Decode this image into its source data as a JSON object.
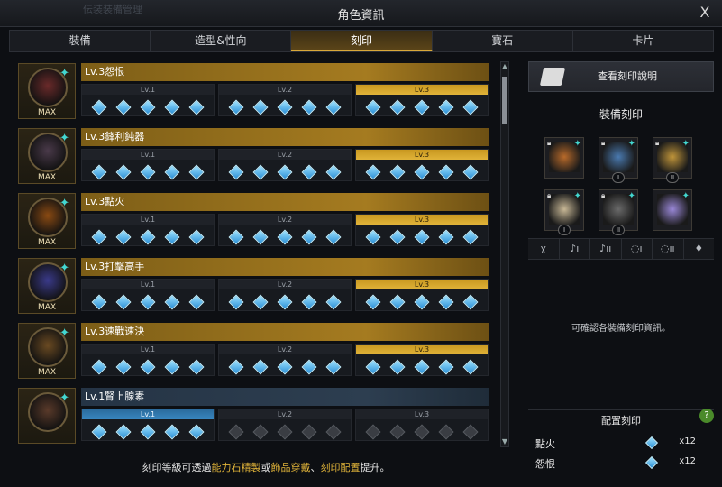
{
  "window": {
    "title": "角色資訊",
    "ghost_title": "伝装装備管理",
    "close_label": "X"
  },
  "tabs": [
    {
      "label": "裝備",
      "active": false
    },
    {
      "label": "造型&性向",
      "active": false
    },
    {
      "label": "刻印",
      "active": true
    },
    {
      "label": "寶石",
      "active": false
    },
    {
      "label": "卡片",
      "active": false
    }
  ],
  "level_labels": [
    "Lv.1",
    "Lv.2",
    "Lv.3"
  ],
  "engravings": [
    {
      "title": "Lv.3怨恨",
      "badge": "MAX",
      "level": 3,
      "max": true,
      "color": "#6a2a2a"
    },
    {
      "title": "Lv.3鋒利鈍器",
      "badge": "MAX",
      "level": 3,
      "max": true,
      "color": "#4a3a4a"
    },
    {
      "title": "Lv.3點火",
      "badge": "MAX",
      "level": 3,
      "max": true,
      "color": "#8a4a12"
    },
    {
      "title": "Lv.3打擊高手",
      "badge": "MAX",
      "level": 3,
      "max": true,
      "color": "#3a3a8a"
    },
    {
      "title": "Lv.3速戰速決",
      "badge": "MAX",
      "level": 3,
      "max": true,
      "color": "#6a4a22"
    },
    {
      "title": "Lv.1腎上腺素",
      "badge": "",
      "level": 1,
      "max": false,
      "color": "#5a3a2a"
    }
  ],
  "right_panel": {
    "explain_button": "查看刻印說明",
    "equip_title": "裝備刻印",
    "slot_tags": [
      "",
      "I",
      "II",
      "I",
      "II",
      ""
    ],
    "slot_colors": [
      "#b86a2a",
      "#4a7ab0",
      "#c0953a",
      "#c8b896",
      "#6a6a6a",
      "#9a88d8"
    ],
    "type_icons": [
      "necklace-icon",
      "earring-1-icon",
      "earring-2-icon",
      "ring-1-icon",
      "ring-2-icon",
      "stone-icon"
    ],
    "type_glyphs": [
      "ɣ",
      "♪ı",
      "♪ıı",
      "◌ı",
      "◌ıı",
      "♦"
    ],
    "info_text": "可確認各裝備刻印資訊。",
    "config_title": "配置刻印",
    "help_label": "?",
    "config_rows": [
      {
        "name": "點火",
        "count": "x12"
      },
      {
        "name": "怨恨",
        "count": "x12"
      }
    ]
  },
  "footer": {
    "prefix": "刻印等級可透過",
    "hl1": "能力石精製",
    "mid1": "或",
    "hl2": "飾品穿戴",
    "mid2": "、",
    "hl3": "刻印配置",
    "suffix": "提升。"
  }
}
